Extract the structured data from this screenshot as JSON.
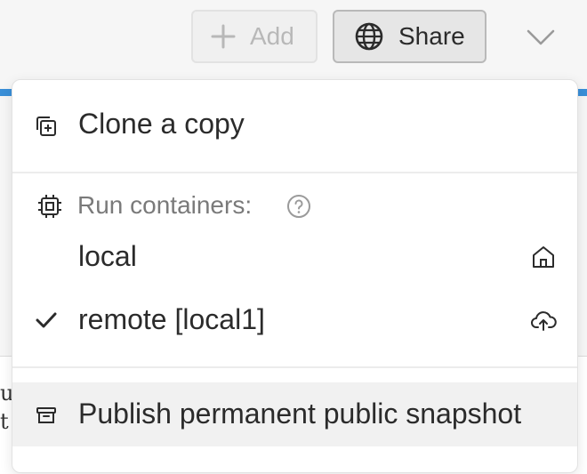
{
  "toolbar": {
    "add_label": "Add",
    "share_label": "Share"
  },
  "background_text": [
    "u",
    "t"
  ],
  "menu": {
    "clone": {
      "label": "Clone a copy",
      "icon": "clone-icon"
    },
    "run_containers": {
      "label": "Run containers:",
      "icon": "chip-icon",
      "help_icon": "help-circle-icon"
    },
    "containers": [
      {
        "label": "local",
        "icon": "home-icon",
        "checked": false
      },
      {
        "label": "remote [local1]",
        "icon": "cloud-upload-icon",
        "checked": true
      }
    ],
    "publish": {
      "label": "Publish permanent public snapshot",
      "icon": "archive-icon"
    }
  }
}
